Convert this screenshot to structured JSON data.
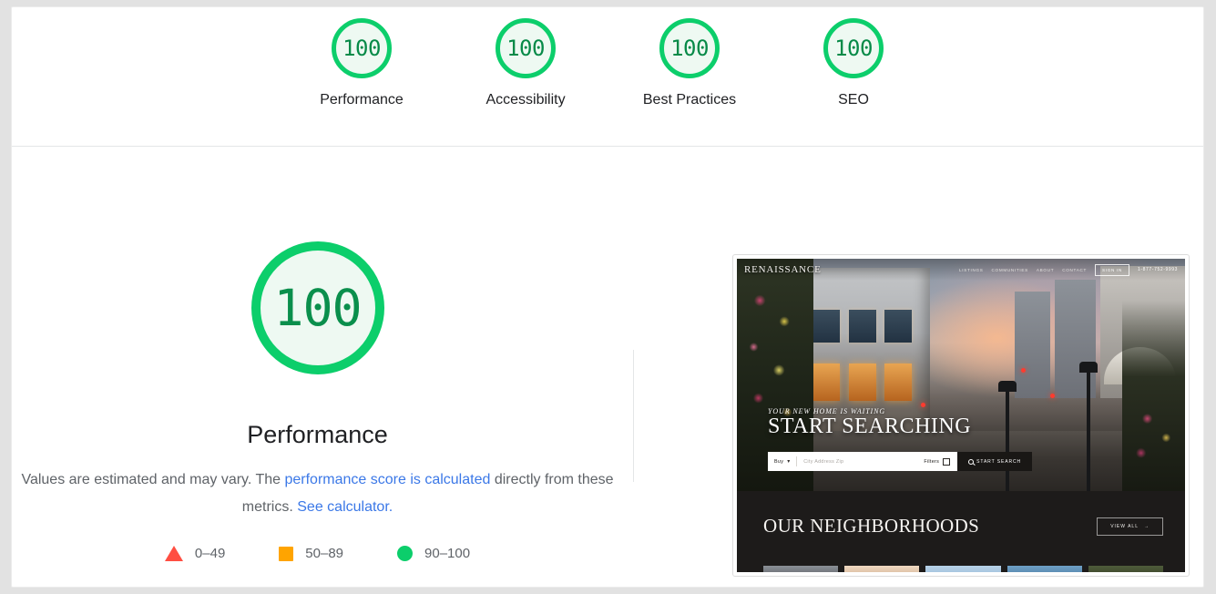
{
  "report": {
    "score_scale": {
      "categories": [
        {
          "score": "100",
          "label": "Performance",
          "color": "#0cce6b"
        },
        {
          "score": "100",
          "label": "Accessibility",
          "color": "#0cce6b"
        },
        {
          "score": "100",
          "label": "Best Practices",
          "color": "#0cce6b"
        },
        {
          "score": "100",
          "label": "SEO",
          "color": "#0cce6b"
        }
      ]
    },
    "performance_section": {
      "score": "100",
      "title": "Performance",
      "description_part1": "Values are estimated and may vary. The ",
      "description_link1": "performance score is calculated",
      "description_part2": " directly from these metrics. ",
      "description_link2": "See calculator.",
      "link_color": "#3b78e7",
      "legend": [
        {
          "marker": "triangle",
          "range": "0–49",
          "color": "#ff4e42"
        },
        {
          "marker": "square",
          "range": "50–89",
          "color": "#ffa400"
        },
        {
          "marker": "circle",
          "range": "90–100",
          "color": "#0cce6b"
        }
      ]
    },
    "final_screenshot": {
      "site": {
        "logo": "RENAISSANCE",
        "nav_items": [
          "LISTINGS",
          "COMMUNITIES",
          "ABOUT",
          "CONTACT"
        ],
        "sign_in": "SIGN IN",
        "phone": "1-877-752-9993",
        "hero_kicker": "YOUR NEW HOME IS WAITING",
        "hero_heading": "START SEARCHING",
        "search": {
          "type_value": "Buy",
          "placeholder": "City Address Zip",
          "filters_label": "Filters",
          "submit_label": "START SEARCH"
        },
        "neighborhoods_title": "OUR NEIGHBORHOODS",
        "view_all_label": "VIEW ALL",
        "view_all_arrow": "→"
      }
    }
  }
}
